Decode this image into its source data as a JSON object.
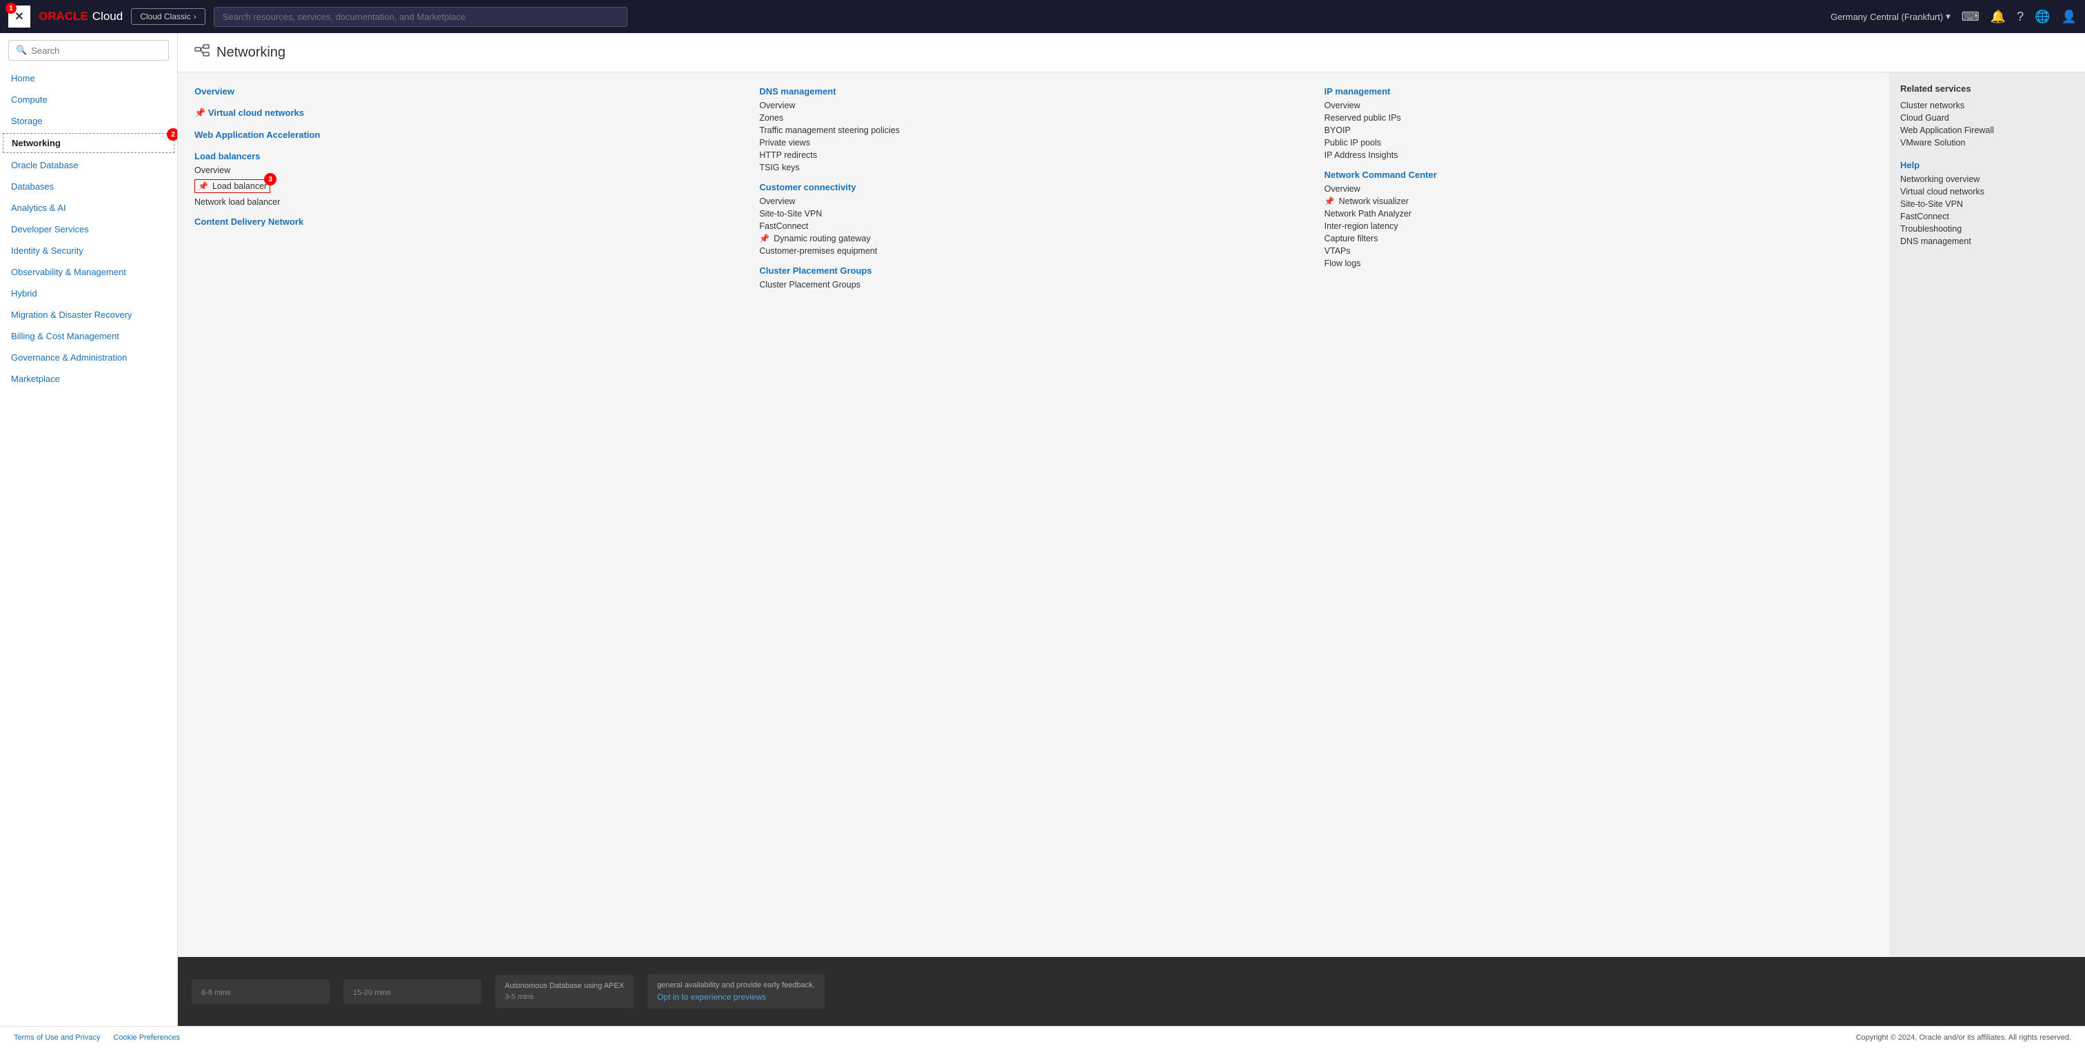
{
  "topnav": {
    "close_label": "×",
    "close_badge": "1",
    "oracle_text": "ORACLE",
    "cloud_text": "Cloud",
    "cloud_classic": "Cloud Classic",
    "search_placeholder": "Search resources, services, documentation, and Marketplace",
    "region": "Germany Central (Frankfurt)"
  },
  "sidebar": {
    "search_placeholder": "Search",
    "items": [
      {
        "id": "home",
        "label": "Home",
        "active": false
      },
      {
        "id": "compute",
        "label": "Compute",
        "active": false
      },
      {
        "id": "storage",
        "label": "Storage",
        "active": false
      },
      {
        "id": "networking",
        "label": "Networking",
        "active": true,
        "badge": "2"
      },
      {
        "id": "oracle-database",
        "label": "Oracle Database",
        "active": false
      },
      {
        "id": "databases",
        "label": "Databases",
        "active": false
      },
      {
        "id": "analytics-ai",
        "label": "Analytics & AI",
        "active": false
      },
      {
        "id": "developer-services",
        "label": "Developer Services",
        "active": false
      },
      {
        "id": "identity-security",
        "label": "Identity & Security",
        "active": false
      },
      {
        "id": "observability",
        "label": "Observability & Management",
        "active": false
      },
      {
        "id": "hybrid",
        "label": "Hybrid",
        "active": false
      },
      {
        "id": "migration",
        "label": "Migration & Disaster Recovery",
        "active": false
      },
      {
        "id": "billing",
        "label": "Billing & Cost Management",
        "active": false
      },
      {
        "id": "governance",
        "label": "Governance & Administration",
        "active": false
      },
      {
        "id": "marketplace",
        "label": "Marketplace",
        "active": false
      }
    ]
  },
  "content": {
    "page_title": "Networking",
    "col1": {
      "sections": [
        {
          "title": "Overview",
          "links": []
        },
        {
          "title": "Virtual cloud networks",
          "pinned": true,
          "links": []
        },
        {
          "title": "Web Application Acceleration",
          "links": []
        },
        {
          "title": "Load balancers",
          "links": [
            {
              "label": "Overview",
              "pinned": false
            },
            {
              "label": "Load balancer",
              "pinned": true,
              "highlighted": true,
              "badge": "3"
            },
            {
              "label": "Network load balancer",
              "pinned": false
            }
          ]
        },
        {
          "title": "Content Delivery Network",
          "links": []
        }
      ]
    },
    "col2": {
      "sections": [
        {
          "title": "DNS management",
          "links": [
            {
              "label": "Overview"
            },
            {
              "label": "Zones"
            },
            {
              "label": "Traffic management steering policies"
            },
            {
              "label": "Private views"
            },
            {
              "label": "HTTP redirects"
            },
            {
              "label": "TSIG keys"
            }
          ]
        },
        {
          "title": "Customer connectivity",
          "links": [
            {
              "label": "Overview"
            },
            {
              "label": "Site-to-Site VPN"
            },
            {
              "label": "FastConnect"
            },
            {
              "label": "Dynamic routing gateway",
              "pinned": true
            },
            {
              "label": "Customer-premises equipment"
            }
          ]
        },
        {
          "title": "Cluster Placement Groups",
          "links": [
            {
              "label": "Cluster Placement Groups"
            }
          ]
        }
      ]
    },
    "col3": {
      "sections": [
        {
          "title": "IP management",
          "links": [
            {
              "label": "Overview"
            },
            {
              "label": "Reserved public IPs"
            },
            {
              "label": "BYOIP"
            },
            {
              "label": "Public IP pools"
            },
            {
              "label": "IP Address Insights"
            }
          ]
        },
        {
          "title": "Network Command Center",
          "links": [
            {
              "label": "Overview"
            },
            {
              "label": "Network visualizer",
              "pinned": true
            },
            {
              "label": "Network Path Analyzer"
            },
            {
              "label": "Inter-region latency"
            },
            {
              "label": "Capture filters"
            },
            {
              "label": "VTAPs"
            },
            {
              "label": "Flow logs"
            }
          ]
        }
      ]
    },
    "related": {
      "title": "Related services",
      "items": [
        "Cluster networks",
        "Cloud Guard",
        "Web Application Firewall",
        "VMware Solution"
      ],
      "help_title": "Help",
      "help_items": [
        "Networking overview",
        "Virtual cloud networks",
        "Site-to-Site VPN",
        "FastConnect",
        "Troubleshooting",
        "DNS management"
      ]
    }
  },
  "bottom": {
    "cards": [
      {
        "title": "6-8 mins",
        "content": ""
      },
      {
        "title": "15-20 mins",
        "content": ""
      },
      {
        "title": "Autonomous Database using APEX",
        "time": "3-5 mins"
      },
      {
        "title": "general availability and provide early feedback.",
        "link": "Opt in to experience previews"
      }
    ]
  },
  "footer": {
    "links": [
      "Terms of Use and Privacy",
      "Cookie Preferences"
    ],
    "copyright": "Copyright © 2024, Oracle and/or its affiliates. All rights reserved."
  }
}
